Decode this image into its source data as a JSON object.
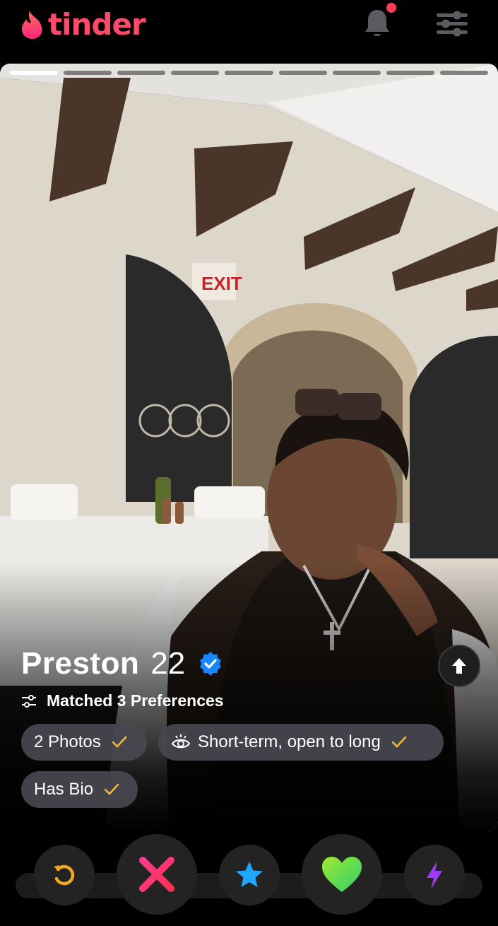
{
  "app": {
    "logo_text": "tinder"
  },
  "header": {
    "notification_dot": true
  },
  "profile": {
    "name": "Preston",
    "age": "22",
    "verified": true,
    "preferences_text": "Matched 3 Preferences",
    "chips": [
      {
        "label": "2 Photos"
      },
      {
        "label": "Short-term, open to long"
      },
      {
        "label": "Has Bio"
      }
    ],
    "photo_count": 9,
    "active_photo_index": 0
  },
  "actions": [
    "rewind-icon",
    "nope-icon",
    "super-like-icon",
    "like-icon",
    "boost-icon"
  ],
  "colors": {
    "brand": "#FE3C72",
    "check": "#F7B733",
    "verified": "#1786FF",
    "rewind": "#F5A623",
    "nope": "#FF2F6E",
    "star": "#1EA7FD",
    "boost": "#9B3DF4"
  }
}
